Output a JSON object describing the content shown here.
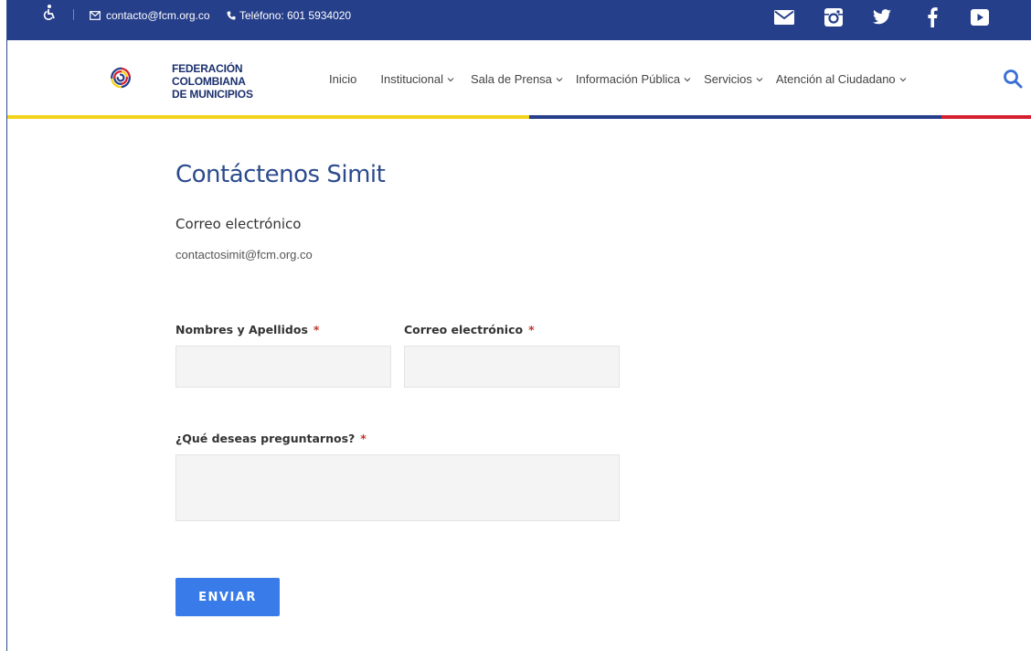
{
  "topbar": {
    "email": "contacto@fcm.org.co",
    "phone": "Teléfono: 601 5934020",
    "socials": [
      "email-icon",
      "instagram-icon",
      "twitter-icon",
      "facebook-icon",
      "youtube-icon"
    ]
  },
  "brand": {
    "line1": "FEDERACIÓN",
    "line2": "COLOMBIANA",
    "line3": "DE MUNICIPIOS",
    "colors": {
      "blue": "#263f8a",
      "yellow": "#f2d21a",
      "red": "#d4202f"
    }
  },
  "nav": {
    "items": [
      {
        "label": "Inicio"
      },
      {
        "label": "Institucional"
      },
      {
        "label": "Sala de Prensa"
      },
      {
        "label": "Información Pública"
      },
      {
        "label": "Servicios"
      },
      {
        "label": "Atención al Ciudadano"
      }
    ]
  },
  "page": {
    "title": "Contáctenos Simit",
    "subheading": "Correo electrónico",
    "contact_email": "contactosimit@fcm.org.co"
  },
  "form": {
    "name_label": "Nombres y Apellidos",
    "email_label": "Correo electrónico",
    "question_label": "¿Qué deseas preguntarnos?",
    "required_mark": "*",
    "name_value": "",
    "email_value": "",
    "question_value": "",
    "submit_label": "ENVIAR"
  },
  "colors": {
    "accent": "#3a7bea",
    "title": "#2c4b8e",
    "required": "#c0392b"
  }
}
